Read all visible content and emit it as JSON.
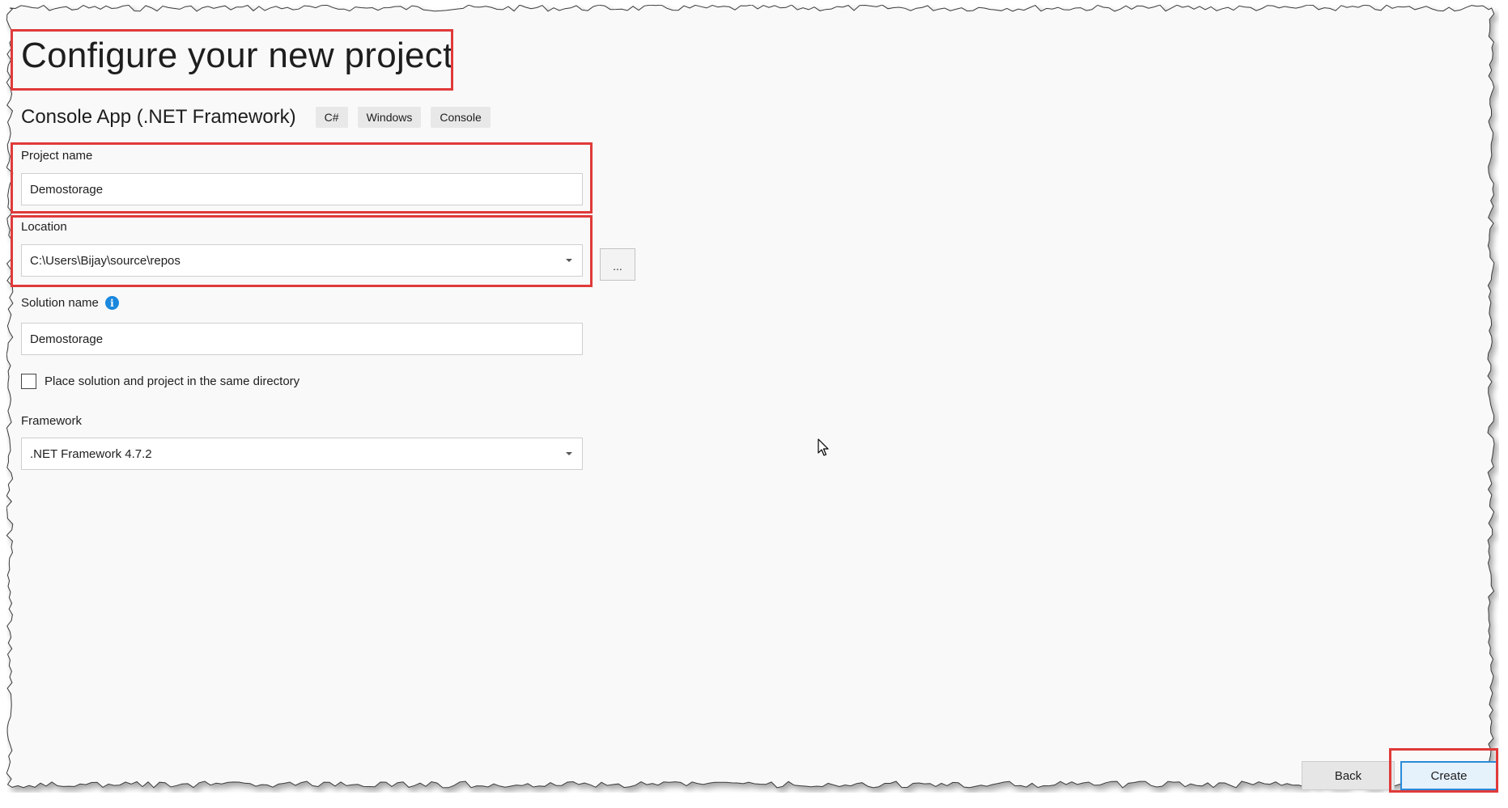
{
  "heading": "Configure your new project",
  "template": {
    "name": "Console App (.NET Framework)",
    "tags": [
      "C#",
      "Windows",
      "Console"
    ]
  },
  "project_name": {
    "label": "Project name",
    "value": "Demostorage"
  },
  "location": {
    "label": "Location",
    "value": "C:\\Users\\Bijay\\source\\repos",
    "browse_label": "..."
  },
  "solution_name": {
    "label": "Solution name",
    "value": "Demostorage",
    "info_icon": "i"
  },
  "same_directory": {
    "label": "Place solution and project in the same directory",
    "checked": false
  },
  "framework": {
    "label": "Framework",
    "value": ".NET Framework 4.7.2"
  },
  "buttons": {
    "back": "Back",
    "create": "Create"
  },
  "colors": {
    "highlight": "#e03a3a",
    "accent": "#1b88dd",
    "canvas": "#f9f9f9"
  }
}
